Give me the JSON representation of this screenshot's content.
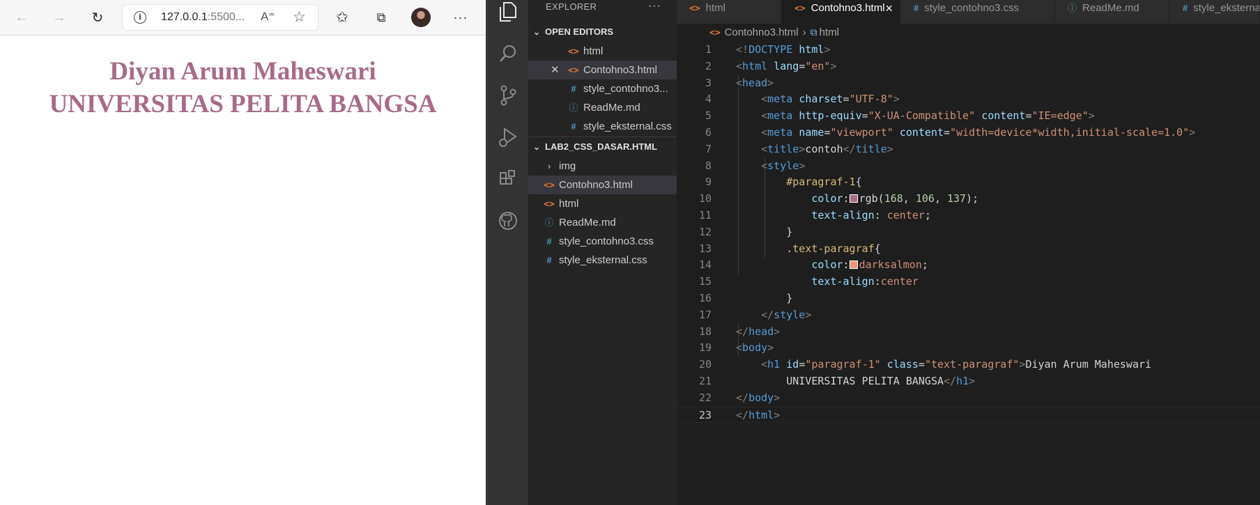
{
  "browser": {
    "url_host": "127.0.0.1",
    "url_rest": ":5500...",
    "heading_line1": "Diyan Arum Maheswari",
    "heading_line2": "UNIVERSITAS PELITA BANGSA"
  },
  "explorer": {
    "title": "EXPLORER",
    "more": "···",
    "open_editors_label": "OPEN EDITORS",
    "open_editors": [
      {
        "label": "html",
        "icon": "html-icon"
      },
      {
        "label": "Contohno3.html",
        "icon": "html-icon"
      },
      {
        "label": "style_contohno3...",
        "icon": "css-icon"
      },
      {
        "label": "ReadMe.md",
        "icon": "info-icon"
      },
      {
        "label": "style_eksternal.css",
        "icon": "css-icon"
      }
    ],
    "folder_label": "LAB2_CSS_DASAR.HTML",
    "folder_items": [
      {
        "label": "img",
        "icon": "chevron-right-icon"
      },
      {
        "label": "Contohno3.html",
        "icon": "html-icon"
      },
      {
        "label": "html",
        "icon": "html-icon"
      },
      {
        "label": "ReadMe.md",
        "icon": "info-icon"
      },
      {
        "label": "style_contohno3.css",
        "icon": "css-icon"
      },
      {
        "label": "style_eksternal.css",
        "icon": "css-icon"
      }
    ]
  },
  "tabs": [
    {
      "label": "html",
      "icon": "html-icon"
    },
    {
      "label": "Contohno3.html",
      "icon": "html-icon",
      "active": true
    },
    {
      "label": "style_contohno3.css",
      "icon": "css-icon"
    },
    {
      "label": "ReadMe.md",
      "icon": "info-icon"
    },
    {
      "label": "style_eksternal.css",
      "icon": "css-icon"
    }
  ],
  "breadcrumb": {
    "file": "Contohno3.html",
    "symbol": "html"
  },
  "code": {
    "line_numbers": [
      "1",
      "2",
      "3",
      "4",
      "5",
      "6",
      "7",
      "8",
      "9",
      "10",
      "11",
      "12",
      "13",
      "14",
      "15",
      "16",
      "17",
      "18",
      "19",
      "20",
      "21",
      "22",
      "23"
    ],
    "current_line": 23
  },
  "colors": {
    "heading": "#a86a89",
    "swatch_rgb": "#a86a89",
    "swatch_darksalmon": "#e9967a"
  }
}
